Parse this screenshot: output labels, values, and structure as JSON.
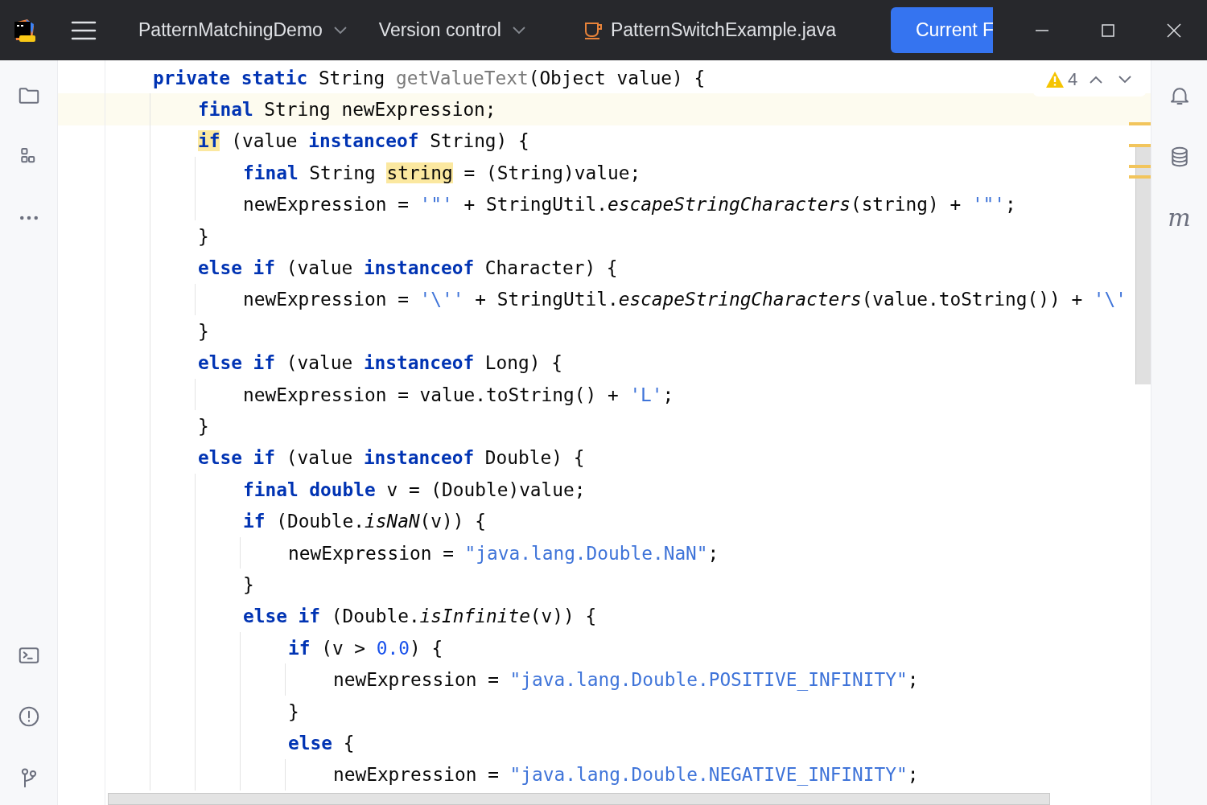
{
  "title_bar": {
    "menu_items": [
      {
        "label": "PatternMatchingDemo",
        "kind": "dropdown"
      },
      {
        "label": "Version control",
        "kind": "dropdown"
      },
      {
        "label": "PatternSwitchExample.java",
        "kind": "file"
      }
    ],
    "run_button": "Current F"
  },
  "inspections": {
    "warnings": "4"
  },
  "right_toolbar": {
    "maven_label": "m"
  },
  "lines": [
    {
      "current": false,
      "tokens": [
        {
          "kind": "kw",
          "text": "private",
          "highlighted": false
        },
        {
          "kind": "kw",
          "text": " static",
          "highlighted": false
        },
        {
          "kind": "plain",
          "text": " String ",
          "highlighted": false
        },
        {
          "kind": "method",
          "text": "getValueText",
          "highlighted": false
        },
        {
          "kind": "plain",
          "text": "(Object value) {",
          "highlighted": false
        }
      ],
      "children": [
        {
          "current": true,
          "tokens": [
            {
              "kind": "kw",
              "text": "final",
              "highlighted": false
            },
            {
              "kind": "plain",
              "text": " String newExpression;",
              "highlighted": false
            }
          ]
        },
        {
          "current": false,
          "tokens": [
            {
              "kind": "kw",
              "text": "if",
              "highlighted": true
            },
            {
              "kind": "plain",
              "text": " (value ",
              "highlighted": false
            },
            {
              "kind": "kw",
              "text": "instanceof",
              "highlighted": false
            },
            {
              "kind": "plain",
              "text": " String) {",
              "highlighted": false
            }
          ],
          "children": [
            {
              "current": false,
              "tokens": [
                {
                  "kind": "kw",
                  "text": "final",
                  "highlighted": false
                },
                {
                  "kind": "plain",
                  "text": " String ",
                  "highlighted": false
                },
                {
                  "kind": "plain",
                  "text": "string",
                  "highlighted": true
                },
                {
                  "kind": "plain",
                  "text": " = (String)value;",
                  "highlighted": false
                }
              ]
            },
            {
              "current": false,
              "tokens": [
                {
                  "kind": "plain",
                  "text": "newExpression = ",
                  "highlighted": false
                },
                {
                  "kind": "str",
                  "text": "'\"'",
                  "highlighted": false
                },
                {
                  "kind": "plain",
                  "text": " + StringUtil.",
                  "highlighted": false
                },
                {
                  "kind": "italic",
                  "text": "escapeStringCharacters",
                  "highlighted": false
                },
                {
                  "kind": "plain",
                  "text": "(string) + ",
                  "highlighted": false
                },
                {
                  "kind": "str",
                  "text": "'\"'",
                  "highlighted": false
                },
                {
                  "kind": "plain",
                  "text": ";",
                  "highlighted": false
                }
              ]
            }
          ]
        },
        {
          "current": false,
          "tokens": [
            {
              "kind": "plain",
              "text": "}",
              "highlighted": false
            }
          ]
        },
        {
          "current": false,
          "tokens": [
            {
              "kind": "kw",
              "text": "else if",
              "highlighted": false
            },
            {
              "kind": "plain",
              "text": " (value ",
              "highlighted": false
            },
            {
              "kind": "kw",
              "text": "instanceof",
              "highlighted": false
            },
            {
              "kind": "plain",
              "text": " Character) {",
              "highlighted": false
            }
          ],
          "children": [
            {
              "current": false,
              "tokens": [
                {
                  "kind": "plain",
                  "text": "newExpression = ",
                  "highlighted": false
                },
                {
                  "kind": "str",
                  "text": "'\\''",
                  "highlighted": false
                },
                {
                  "kind": "plain",
                  "text": " + StringUtil.",
                  "highlighted": false
                },
                {
                  "kind": "italic",
                  "text": "escapeStringCharacters",
                  "highlighted": false
                },
                {
                  "kind": "plain",
                  "text": "(value.toString()) + ",
                  "highlighted": false
                },
                {
                  "kind": "str",
                  "text": "'\\'",
                  "highlighted": false
                }
              ]
            }
          ]
        },
        {
          "current": false,
          "tokens": [
            {
              "kind": "plain",
              "text": "}",
              "highlighted": false
            }
          ]
        },
        {
          "current": false,
          "tokens": [
            {
              "kind": "kw",
              "text": "else if",
              "highlighted": false
            },
            {
              "kind": "plain",
              "text": " (value ",
              "highlighted": false
            },
            {
              "kind": "kw",
              "text": "instanceof",
              "highlighted": false
            },
            {
              "kind": "plain",
              "text": " Long) {",
              "highlighted": false
            }
          ],
          "children": [
            {
              "current": false,
              "tokens": [
                {
                  "kind": "plain",
                  "text": "newExpression = value.toString() + ",
                  "highlighted": false
                },
                {
                  "kind": "str",
                  "text": "'L'",
                  "highlighted": false
                },
                {
                  "kind": "plain",
                  "text": ";",
                  "highlighted": false
                }
              ]
            }
          ]
        },
        {
          "current": false,
          "tokens": [
            {
              "kind": "plain",
              "text": "}",
              "highlighted": false
            }
          ]
        },
        {
          "current": false,
          "tokens": [
            {
              "kind": "kw",
              "text": "else if",
              "highlighted": false
            },
            {
              "kind": "plain",
              "text": " (value ",
              "highlighted": false
            },
            {
              "kind": "kw",
              "text": "instanceof",
              "highlighted": false
            },
            {
              "kind": "plain",
              "text": " Double) {",
              "highlighted": false
            }
          ],
          "children": [
            {
              "current": false,
              "tokens": [
                {
                  "kind": "kw",
                  "text": "final double",
                  "highlighted": false
                },
                {
                  "kind": "plain",
                  "text": " v = (Double)value;",
                  "highlighted": false
                }
              ]
            },
            {
              "current": false,
              "tokens": [
                {
                  "kind": "kw",
                  "text": "if",
                  "highlighted": false
                },
                {
                  "kind": "plain",
                  "text": " (Double.",
                  "highlighted": false
                },
                {
                  "kind": "italic",
                  "text": "isNaN",
                  "highlighted": false
                },
                {
                  "kind": "plain",
                  "text": "(v)) {",
                  "highlighted": false
                }
              ],
              "children": [
                {
                  "current": false,
                  "tokens": [
                    {
                      "kind": "plain",
                      "text": "newExpression = ",
                      "highlighted": false
                    },
                    {
                      "kind": "str",
                      "text": "\"java.lang.Double.NaN\"",
                      "highlighted": false
                    },
                    {
                      "kind": "plain",
                      "text": ";",
                      "highlighted": false
                    }
                  ]
                }
              ]
            },
            {
              "current": false,
              "tokens": [
                {
                  "kind": "plain",
                  "text": "}",
                  "highlighted": false
                }
              ]
            },
            {
              "current": false,
              "tokens": [
                {
                  "kind": "kw",
                  "text": "else if",
                  "highlighted": false
                },
                {
                  "kind": "plain",
                  "text": " (Double.",
                  "highlighted": false
                },
                {
                  "kind": "italic",
                  "text": "isInfinite",
                  "highlighted": false
                },
                {
                  "kind": "plain",
                  "text": "(v)) {",
                  "highlighted": false
                }
              ],
              "children": [
                {
                  "current": false,
                  "tokens": [
                    {
                      "kind": "kw",
                      "text": "if",
                      "highlighted": false
                    },
                    {
                      "kind": "plain",
                      "text": " (v > ",
                      "highlighted": false
                    },
                    {
                      "kind": "num",
                      "text": "0.0",
                      "highlighted": false
                    },
                    {
                      "kind": "plain",
                      "text": ") {",
                      "highlighted": false
                    }
                  ],
                  "children": [
                    {
                      "current": false,
                      "tokens": [
                        {
                          "kind": "plain",
                          "text": "newExpression = ",
                          "highlighted": false
                        },
                        {
                          "kind": "str",
                          "text": "\"java.lang.Double.POSITIVE_INFINITY\"",
                          "highlighted": false
                        },
                        {
                          "kind": "plain",
                          "text": ";",
                          "highlighted": false
                        }
                      ]
                    }
                  ]
                },
                {
                  "current": false,
                  "tokens": [
                    {
                      "kind": "plain",
                      "text": "}",
                      "highlighted": false
                    }
                  ]
                },
                {
                  "current": false,
                  "tokens": [
                    {
                      "kind": "kw",
                      "text": "else",
                      "highlighted": false
                    },
                    {
                      "kind": "plain",
                      "text": " {",
                      "highlighted": false
                    }
                  ],
                  "children": [
                    {
                      "current": false,
                      "tokens": [
                        {
                          "kind": "plain",
                          "text": "newExpression = ",
                          "highlighted": false
                        },
                        {
                          "kind": "str",
                          "text": "\"java.lang.Double.NEGATIVE_INFINITY\"",
                          "highlighted": false
                        },
                        {
                          "kind": "plain",
                          "text": ";",
                          "highlighted": false
                        }
                      ]
                    }
                  ]
                }
              ]
            }
          ]
        }
      ]
    }
  ]
}
